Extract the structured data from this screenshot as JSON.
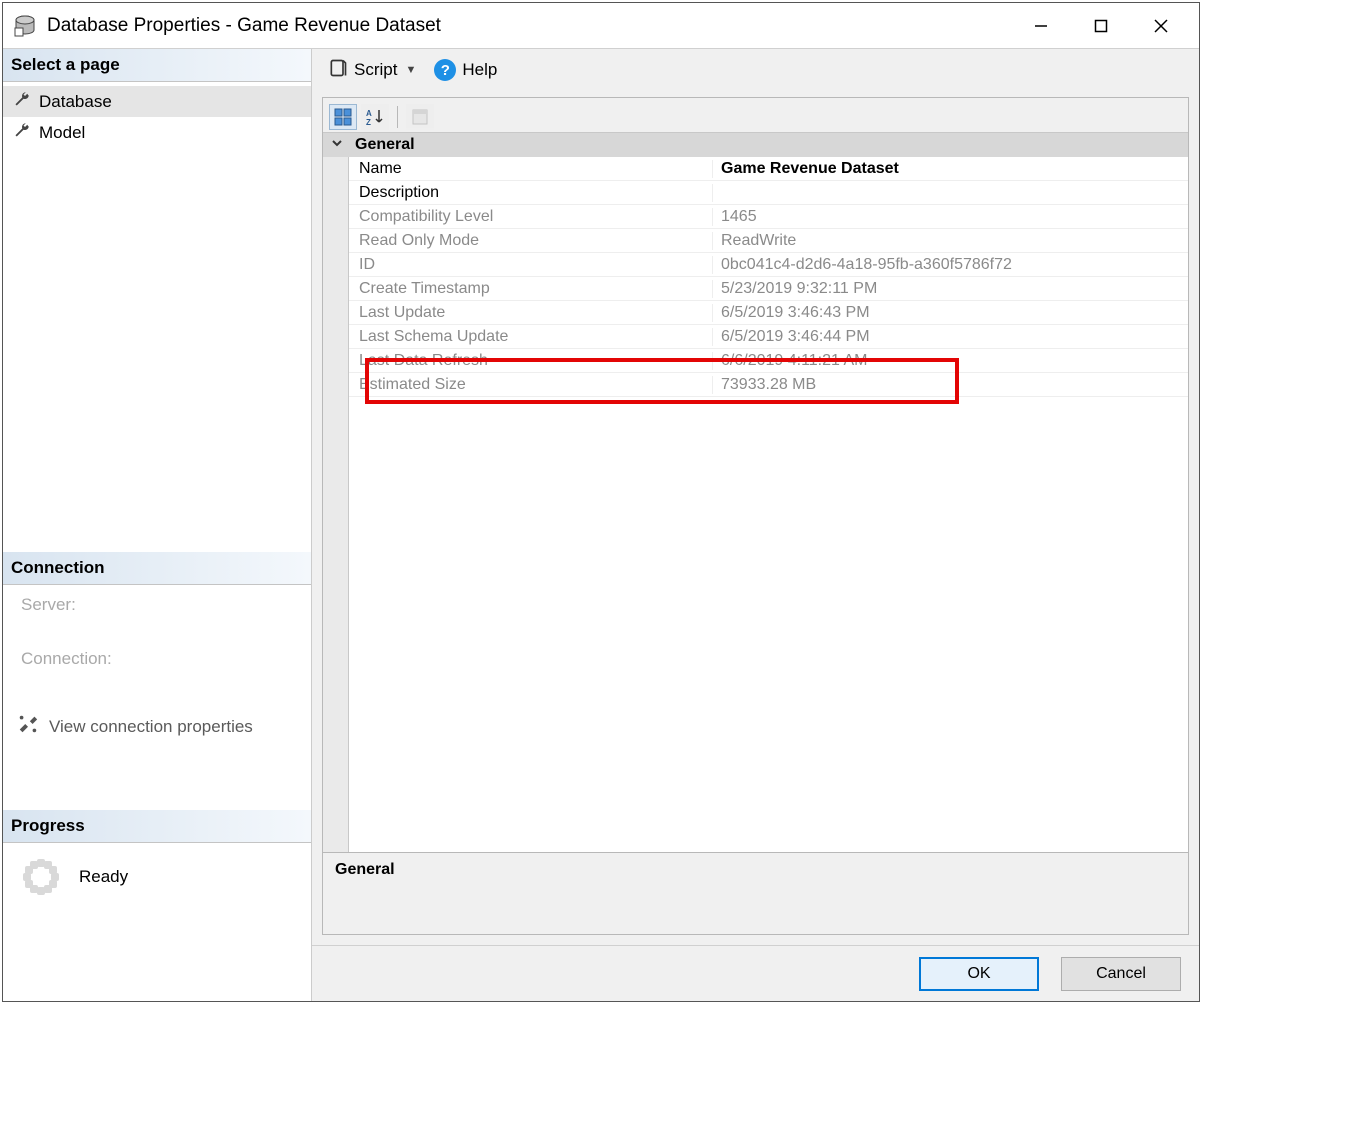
{
  "window": {
    "title": "Database Properties - Game Revenue Dataset"
  },
  "sidebar": {
    "select_page_header": "Select a page",
    "pages": [
      {
        "label": "Database",
        "selected": true
      },
      {
        "label": "Model",
        "selected": false
      }
    ],
    "connection": {
      "header": "Connection",
      "server_label": "Server:",
      "connection_label": "Connection:",
      "view_props_label": "View connection properties"
    },
    "progress": {
      "header": "Progress",
      "status": "Ready"
    }
  },
  "toolbar": {
    "script_label": "Script",
    "help_label": "Help"
  },
  "grid": {
    "category_label": "General",
    "rows": [
      {
        "label": "Name",
        "value": "Game Revenue Dataset",
        "readonly": false
      },
      {
        "label": "Description",
        "value": "",
        "readonly": false
      },
      {
        "label": "Compatibility Level",
        "value": "1465",
        "readonly": true
      },
      {
        "label": "Read Only Mode",
        "value": "ReadWrite",
        "readonly": true
      },
      {
        "label": "ID",
        "value": "0bc041c4-d2d6-4a18-95fb-a360f5786f72",
        "readonly": true
      },
      {
        "label": "Create Timestamp",
        "value": "5/23/2019 9:32:11 PM",
        "readonly": true
      },
      {
        "label": "Last Update",
        "value": "6/5/2019 3:46:43 PM",
        "readonly": true
      },
      {
        "label": "Last Schema Update",
        "value": "6/5/2019 3:46:44 PM",
        "readonly": true
      },
      {
        "label": "Last Data Refresh",
        "value": "6/6/2019 4:11:21 AM",
        "readonly": true
      },
      {
        "label": "Estimated Size",
        "value": "73933.28 MB",
        "readonly": true
      }
    ],
    "highlight_row_label": "Estimated Size",
    "desc_title": "General"
  },
  "footer": {
    "ok_label": "OK",
    "cancel_label": "Cancel"
  }
}
